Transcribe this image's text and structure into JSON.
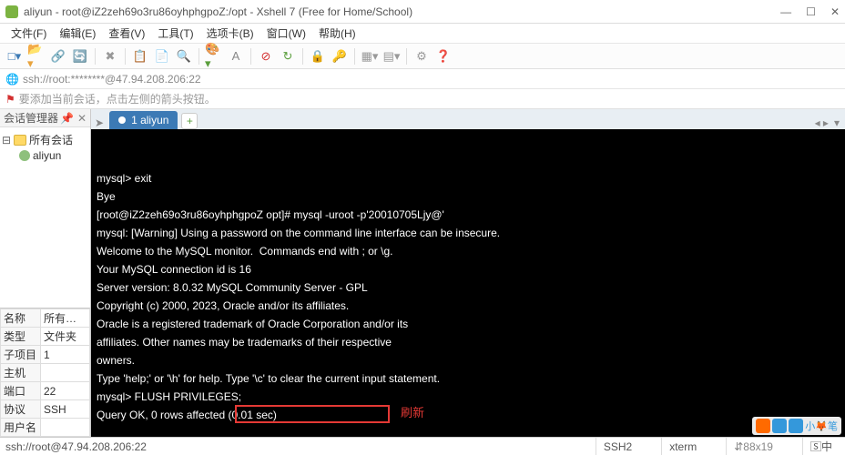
{
  "window": {
    "title": "aliyun - root@iZ2zeh69o3ru86oyhphgpoZ:/opt - Xshell 7 (Free for Home/School)"
  },
  "menu": {
    "file": "文件(F)",
    "edit": "编辑(E)",
    "view": "查看(V)",
    "tools": "工具(T)",
    "tabs": "选项卡(B)",
    "window": "窗口(W)",
    "help": "帮助(H)"
  },
  "address": {
    "text": "ssh://root:********@47.94.208.206:22"
  },
  "hint": {
    "text": "要添加当前会话，点击左侧的箭头按钮。"
  },
  "session_manager": {
    "title": "会话管理器",
    "root": "所有会话",
    "leaf": "aliyun"
  },
  "props": {
    "rows": [
      {
        "k": "名称",
        "v": "所有…"
      },
      {
        "k": "类型",
        "v": "文件夹"
      },
      {
        "k": "子项目",
        "v": "1"
      },
      {
        "k": "主机",
        "v": ""
      },
      {
        "k": "端口",
        "v": "22"
      },
      {
        "k": "协议",
        "v": "SSH"
      },
      {
        "k": "用户名",
        "v": ""
      }
    ]
  },
  "tab": {
    "label": "1 aliyun"
  },
  "terminal": {
    "lines": [
      "",
      "mysql> exit",
      "Bye",
      "[root@iZ2zeh69o3ru86oyhphgpoZ opt]# mysql -uroot -p'20010705Ljy@'",
      "mysql: [Warning] Using a password on the command line interface can be insecure.",
      "Welcome to the MySQL monitor.  Commands end with ; or \\g.",
      "Your MySQL connection id is 16",
      "Server version: 8.0.32 MySQL Community Server - GPL",
      "",
      "Copyright (c) 2000, 2023, Oracle and/or its affiliates.",
      "",
      "Oracle is a registered trademark of Oracle Corporation and/or its",
      "affiliates. Other names may be trademarks of their respective",
      "owners.",
      "",
      "Type 'help;' or '\\h' for help. Type '\\c' to clear the current input statement.",
      "",
      "mysql> FLUSH PRIVILEGES;",
      "Query OK, 0 rows affected (0.01 sec)"
    ],
    "highlight_label": "刷新"
  },
  "status": {
    "conn": "ssh://root@47.94.208.206:22",
    "encoding": "SSH2",
    "term": "xterm",
    "size": "88x19",
    "caps": "中"
  }
}
